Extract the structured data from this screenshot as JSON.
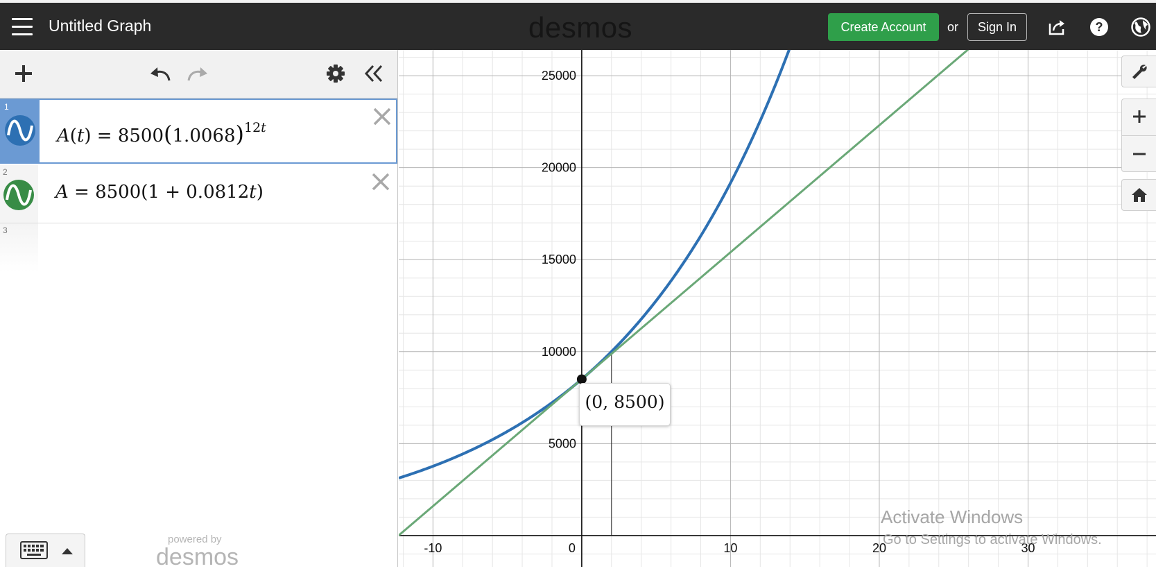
{
  "header": {
    "title": "Untitled Graph",
    "brand": "desmos",
    "create_account": "Create Account",
    "or": "or",
    "sign_in": "Sign In"
  },
  "expressions": [
    {
      "num": "1",
      "color": "#2d70b3"
    },
    {
      "num": "2",
      "color": "#388c46"
    },
    {
      "num": "3"
    }
  ],
  "footer": {
    "powered_by": "powered by",
    "brand": "desmos"
  },
  "point_label": "(0, 8500)",
  "watermark": {
    "line1": "Activate Windows",
    "line2": "Go to Settings to activate Windows."
  },
  "chart_data": {
    "type": "line",
    "xlim": [
      -12.3,
      38.6
    ],
    "ylim": [
      -1700,
      26400
    ],
    "x_ticks": [
      -10,
      0,
      10,
      20,
      30
    ],
    "y_ticks": [
      5000,
      10000,
      15000,
      20000,
      25000
    ],
    "grid": true,
    "series": [
      {
        "expression": "A(t)=8500(1.0068)^{12t}",
        "color": "#2d70b3"
      },
      {
        "expression": "A=8500(1+0.0812t)",
        "color": "#6aa877"
      }
    ],
    "point": {
      "x": 0,
      "y": 8500
    },
    "vertical_marker_x": 2
  }
}
